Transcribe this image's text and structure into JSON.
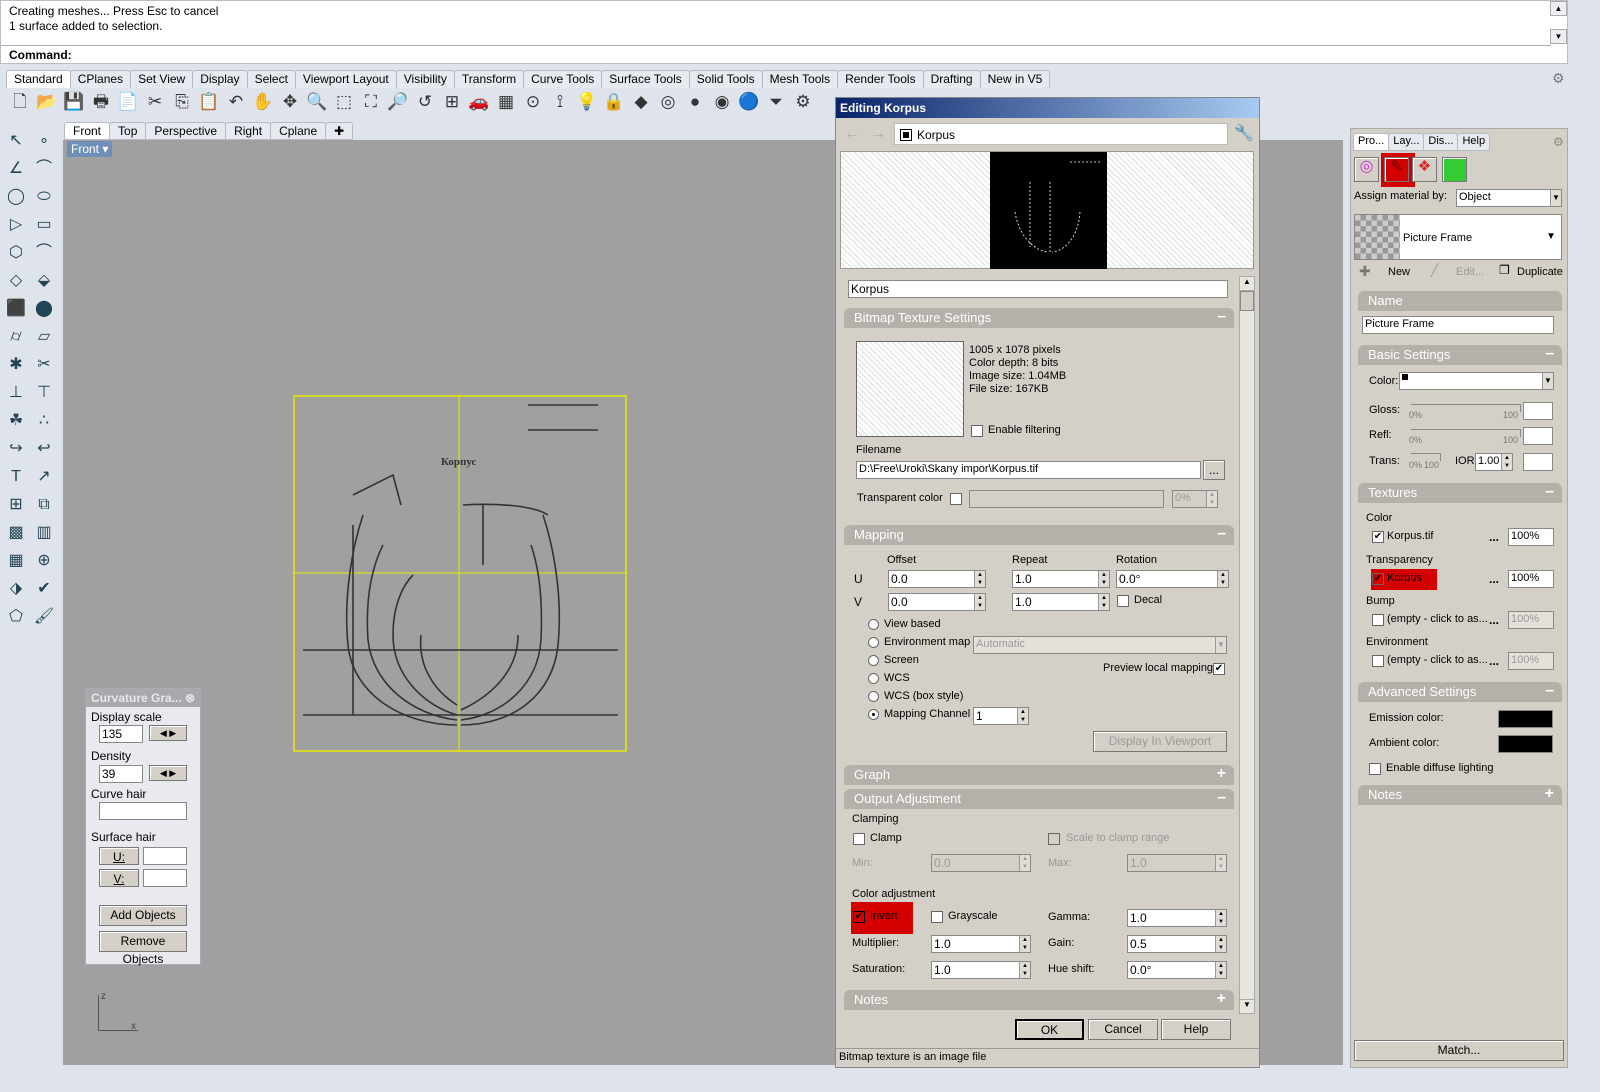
{
  "command": {
    "lines": [
      "Creating meshes... Press Esc to cancel",
      "1 surface added to selection."
    ],
    "prompt": "Command:"
  },
  "toolbar_tabs": [
    "Standard",
    "CPlanes",
    "Set View",
    "Display",
    "Select",
    "Viewport Layout",
    "Visibility",
    "Transform",
    "Curve Tools",
    "Surface Tools",
    "Solid Tools",
    "Mesh Tools",
    "Render Tools",
    "Drafting",
    "New in V5"
  ],
  "toolbar_icons": [
    [
      "new-icon",
      "🗋"
    ],
    [
      "open-icon",
      "📂"
    ],
    [
      "save-icon",
      "💾"
    ],
    [
      "print-icon",
      "🖶"
    ],
    [
      "import-icon",
      "📄"
    ],
    [
      "cut-icon",
      "✂"
    ],
    [
      "copy-icon",
      "⎘"
    ],
    [
      "paste-icon",
      "📋"
    ],
    [
      "undo-icon",
      "↶"
    ],
    [
      "pan-icon",
      "✋"
    ],
    [
      "rotate-view-icon",
      "✥"
    ],
    [
      "zoom-icon",
      "🔍"
    ],
    [
      "zoom-window-icon",
      "⬚"
    ],
    [
      "zoom-extents-icon",
      "⛶"
    ],
    [
      "zoom-selected-icon",
      "🔎"
    ],
    [
      "undo-view-icon",
      "↺"
    ],
    [
      "viewport-layout-icon",
      "⊞"
    ],
    [
      "car-icon",
      "🚗"
    ],
    [
      "grid-icon",
      "▦"
    ],
    [
      "osnap-icon",
      "⊙"
    ],
    [
      "gumball-icon",
      "⟟"
    ],
    [
      "light-icon",
      "💡"
    ],
    [
      "lock-icon",
      "🔒"
    ],
    [
      "layer-icon",
      "◆"
    ],
    [
      "color-wheel-icon",
      "◎"
    ],
    [
      "shaded-icon",
      "●"
    ],
    [
      "render-preview-icon",
      "◉"
    ],
    [
      "render-icon",
      "🔵"
    ],
    [
      "filter-icon",
      "⏷"
    ],
    [
      "options-icon",
      "⚙"
    ]
  ],
  "left_tools": [
    [
      "select-icon",
      "↖"
    ],
    [
      "point-icon",
      "∘"
    ],
    [
      "polyline-icon",
      "∠"
    ],
    [
      "curve-icon",
      "⌒"
    ],
    [
      "circle-icon",
      "◯"
    ],
    [
      "ellipse-icon",
      "⬭"
    ],
    [
      "polygon-icon",
      "▷"
    ],
    [
      "rectangle-icon",
      "▭"
    ],
    [
      "fillet-icon",
      "⬡"
    ],
    [
      "arc-icon",
      "⌒"
    ],
    [
      "surface-icon",
      "◇"
    ],
    [
      "extrude-icon",
      "⬙"
    ],
    [
      "box-icon",
      "⬛"
    ],
    [
      "sphere-icon",
      "⬤"
    ],
    [
      "cylinder-icon",
      "⌭"
    ],
    [
      "plane-icon",
      "▱"
    ],
    [
      "boolean-icon",
      "✱"
    ],
    [
      "trim-icon",
      "✂"
    ],
    [
      "split-icon",
      "⊥"
    ],
    [
      "join-icon",
      "⊤"
    ],
    [
      "explode-icon",
      "☘"
    ],
    [
      "group-icon",
      "∴"
    ],
    [
      "offset-icon",
      "↪"
    ],
    [
      "chamfer-icon",
      "↩"
    ],
    [
      "text-icon",
      "T"
    ],
    [
      "dimension-icon",
      "↗"
    ],
    [
      "array-icon",
      "⊞"
    ],
    [
      "mirror-icon",
      "⧉"
    ],
    [
      "mesh-icon",
      "▩"
    ],
    [
      "hatch-icon",
      "▥"
    ],
    [
      "grid-array-icon",
      "▦"
    ],
    [
      "snap-icon",
      "⊕"
    ],
    [
      "analyze-icon",
      "⬗"
    ],
    [
      "check-icon",
      "✔"
    ],
    [
      "render-mesh-icon",
      "⬠"
    ],
    [
      "paint-icon",
      "🖌"
    ]
  ],
  "viewport_tabs": [
    "Front",
    "Top",
    "Perspective",
    "Right",
    "Cplane"
  ],
  "viewport": {
    "label": "Front",
    "axis_z": "z",
    "axis_x": "x",
    "drawing_title": "Корпус"
  },
  "curvature": {
    "title": "Curvature Gra...",
    "display_scale_label": "Display scale",
    "display_scale": "135",
    "density_label": "Density",
    "density": "39",
    "curve_hair_label": "Curve hair",
    "surface_hair_label": "Surface hair",
    "u_label": "U:",
    "v_label": "V:",
    "add_objects": "Add Objects",
    "remove_objects": "Remove Objects"
  },
  "dialog": {
    "title": "Editing Korpus",
    "breadcrumb": "Korpus",
    "name_value": "Korpus",
    "bitmap": {
      "header": "Bitmap Texture Settings",
      "info": [
        "1005 x 1078 pixels",
        "Color depth: 8 bits",
        "Image size: 1.04MB",
        "File size: 167KB"
      ],
      "enable_filtering": "Enable filtering",
      "filename_label": "Filename",
      "filename": "D:\\Free\\Uroki\\Skany impor\\Korpus.tif",
      "browse": "...",
      "transparent_color": "Transparent color",
      "transparent_pct": "0%"
    },
    "mapping": {
      "header": "Mapping",
      "offset": "Offset",
      "repeat": "Repeat",
      "rotation": "Rotation",
      "u": "U",
      "v": "V",
      "offset_u": "0.0",
      "offset_v": "0.0",
      "repeat_u": "1.0",
      "repeat_v": "1.0",
      "rotation_value": "0.0°",
      "decal": "Decal",
      "options": [
        "View based",
        "Environment map",
        "Screen",
        "WCS",
        "WCS (box style)",
        "Mapping Channel"
      ],
      "selected": "Mapping Channel",
      "env_select": "Automatic",
      "preview_local": "Preview local mapping",
      "channel": "1",
      "display_in_viewport": "Display In Viewport"
    },
    "graph_header": "Graph",
    "output": {
      "header": "Output Adjustment",
      "clamping": "Clamping",
      "clamp": "Clamp",
      "scale_to_clamp": "Scale to clamp range",
      "min_label": "Min:",
      "min": "0.0",
      "max_label": "Max:",
      "max": "1.0",
      "color_adjustment": "Color adjustment",
      "invert": "Invert",
      "grayscale": "Grayscale",
      "gamma_label": "Gamma:",
      "gamma": "1.0",
      "multiplier_label": "Multiplier:",
      "multiplier": "1.0",
      "gain_label": "Gain:",
      "gain": "0.5",
      "saturation_label": "Saturation:",
      "saturation": "1.0",
      "hue_label": "Hue shift:",
      "hue": "0.0°"
    },
    "notes_header": "Notes",
    "ok": "OK",
    "cancel": "Cancel",
    "help": "Help",
    "status": "Bitmap texture is an image file"
  },
  "right_panel": {
    "tabs": [
      "Pro...",
      "Lay...",
      "Dis...",
      "Help"
    ],
    "assign_label": "Assign material by:",
    "assign_value": "Object",
    "material_name": "Picture Frame",
    "new": "New",
    "edit": "Edit...",
    "duplicate": "Duplicate",
    "name_header": "Name",
    "name_value": "Picture Frame",
    "basic_header": "Basic Settings",
    "color_label": "Color:",
    "gloss_label": "Gloss:",
    "refl_label": "Refl:",
    "trans_label": "Trans:",
    "zero_pct": "0%",
    "hundred": "100",
    "ior_label": "IOR:",
    "ior": "1.00",
    "textures_header": "Textures",
    "color_tex_label": "Color",
    "color_tex": "Korpus.tif",
    "transparency_label": "Transparency",
    "transparency_tex": "Korpus",
    "bump_label": "Bump",
    "environment_label": "Environment",
    "empty_tex": "(empty - click to as...",
    "dots": "...",
    "pct": "100%",
    "advanced_header": "Advanced Settings",
    "emission_label": "Emission color:",
    "ambient_label": "Ambient color:",
    "diffuse_lighting": "Enable diffuse lighting",
    "notes_header": "Notes",
    "match": "Match..."
  },
  "colors": {
    "highlight": "#d40000",
    "viewport": "#a0a0a0",
    "frame": "#e8e800",
    "title_bar": "#0a246a"
  }
}
